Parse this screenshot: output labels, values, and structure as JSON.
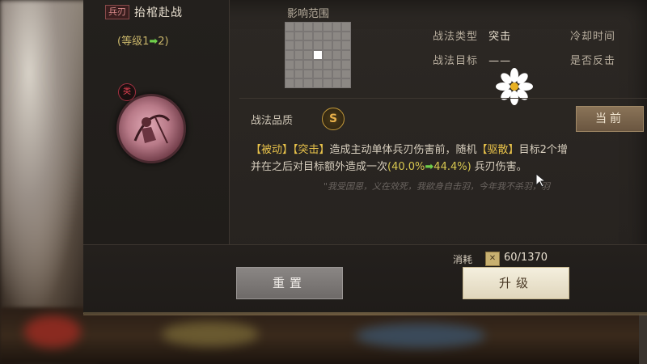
{
  "skill": {
    "type_tag": "兵刃",
    "name": "抬棺赴战",
    "level_prefix": "(等级1",
    "level_arrow": "➡",
    "level_suffix": "2)",
    "badge": "类"
  },
  "range": {
    "label": "影响范围"
  },
  "info": {
    "type_label": "战法类型",
    "type_value": "突击",
    "target_label": "战法目标",
    "target_value": "——",
    "cooldown_label": "冷却时间",
    "counter_label": "是否反击"
  },
  "quality": {
    "label": "战法品质",
    "grade": "S",
    "current_button": "当前"
  },
  "description": {
    "t1": "【被动】",
    "t2": "【突击】",
    "t3": "造成主动单体兵刃伤害前，随机",
    "t4": "【驱散】",
    "t5": "目标2个增",
    "l2a": "并在之后对目标额外造成一次",
    "l2b": "(40.0%",
    "l2c": "➡",
    "l2d": "44.4%)",
    "l2e": "兵刃伤害。"
  },
  "quote": "\"我受国恩，义在效死，我欲身自击羽，今年我不杀羽，羽",
  "footer": {
    "reset_button": "重置",
    "upgrade_button": "升级",
    "cost_label": "消耗",
    "cost_icon": "✕",
    "cost_value": "60/1370"
  },
  "colors": {
    "accent_green": "#6fcf4a",
    "keyword_gold": "#e8c24a",
    "badge_gold": "#c49a3a"
  }
}
